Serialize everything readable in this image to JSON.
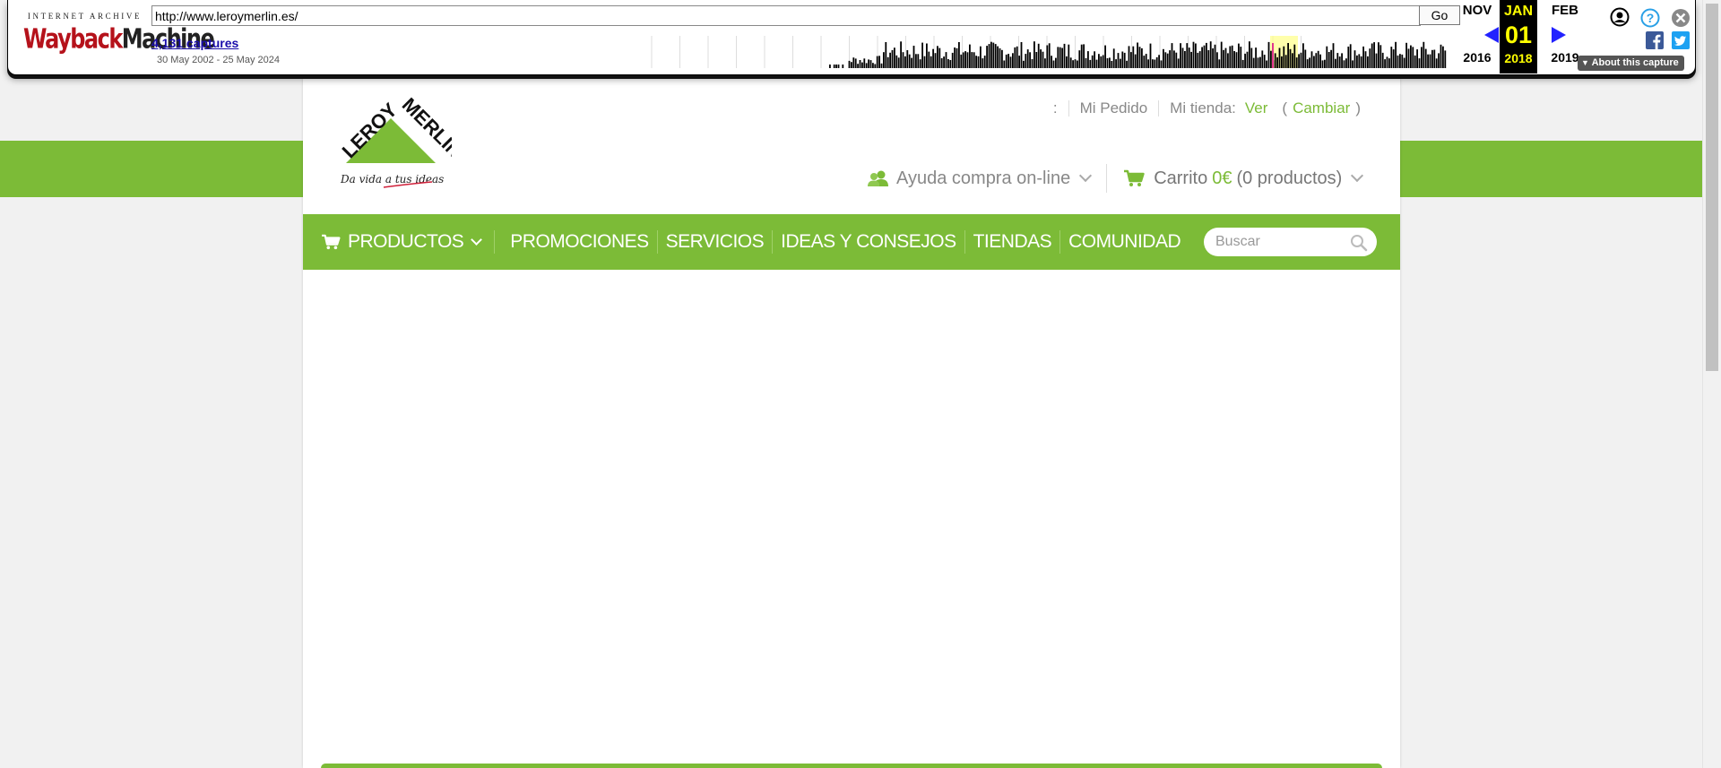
{
  "wayback": {
    "logo_top": "INTERNET ARCHIVE",
    "logo_way": "Wayback",
    "logo_machine": "Machine",
    "url": "http://www.leroymerlin.es/",
    "go_label": "Go",
    "captures": "4,131 captures",
    "date_range": "30 May 2002 - 25 May 2024",
    "prev_month": "NOV",
    "prev_year": "2016",
    "cur_month": "JAN",
    "cur_day": "01",
    "cur_year": "2018",
    "next_month": "FEB",
    "next_year": "2019",
    "about_label": "About this capture",
    "accent_color": "#2222ff",
    "current_bg": "#000000",
    "current_fg": "#ffff00"
  },
  "header": {
    "brand_line1": "LEROY",
    "brand_line2": "MERLIN",
    "tagline": "Da vida a tus ideas",
    "colon": ":",
    "mi_pedido": "Mi Pedido",
    "mi_tienda": "Mi tienda:",
    "ver": "Ver",
    "cambiar_open": "(",
    "cambiar": "Cambiar",
    "cambiar_close": ")",
    "help_label": "Ayuda compra on-line",
    "cart_label": "Carrito",
    "cart_amount": "0€",
    "cart_count": "(0 productos)"
  },
  "nav": {
    "items": [
      "PRODUCTOS",
      "PROMOCIONES",
      "SERVICIOS",
      "IDEAS Y CONSEJOS",
      "TIENDAS",
      "COMUNIDAD"
    ],
    "search_placeholder": "Buscar"
  },
  "colors": {
    "brand_green": "#7cbb37",
    "page_bg": "#f1f1f1"
  }
}
